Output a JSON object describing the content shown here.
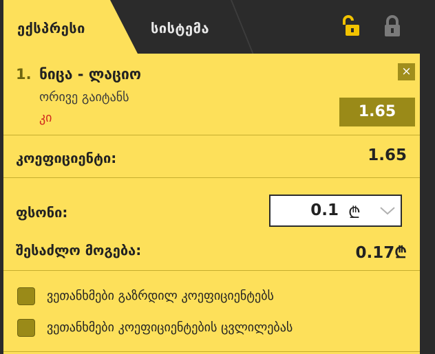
{
  "tabs": {
    "express": "ექსპრესი",
    "system": "სისტემა"
  },
  "bet": {
    "number": "1.",
    "title": "ნიცა - ლაციო",
    "market": "ორივე გაიტანს",
    "pick": "კი",
    "odd": "1.65",
    "close": "×"
  },
  "summary": {
    "coef_label": "კოეფიციენტი:",
    "coef_value": "1.65",
    "stake_label": "ფსონი:",
    "stake_value": "0.1",
    "currency": "₾",
    "win_label": "შესაძლო მოგება:",
    "win_value": "0.17₾"
  },
  "options": [
    "ვეთანხმები გაზრდილ კოეფიციენტებს",
    "ვეთანხმები კოეფიციენტების ცვლილებას"
  ],
  "colors": {
    "panel": "#fde05a",
    "dark": "#2b2b2b",
    "accent": "#9a8a18",
    "pick": "#d0281e"
  }
}
